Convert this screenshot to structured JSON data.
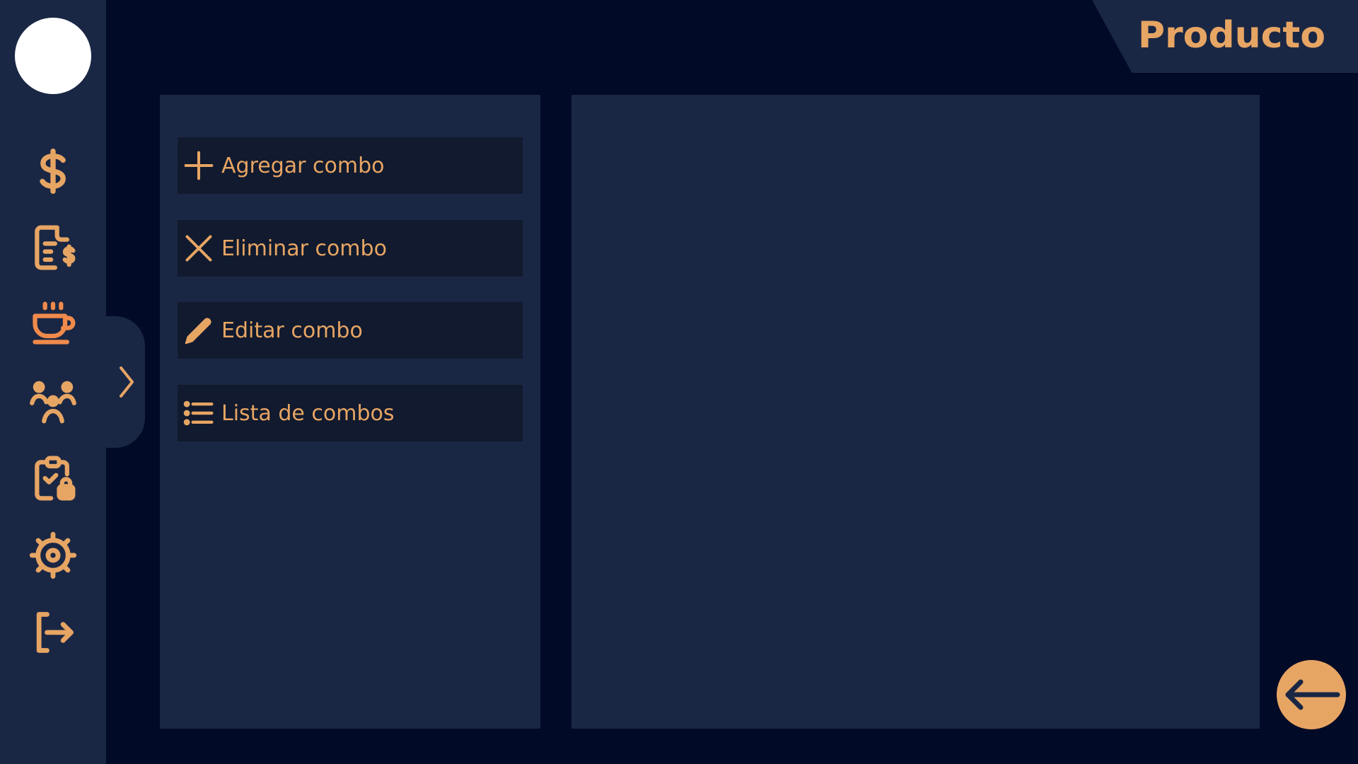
{
  "header": {
    "title": "Producto"
  },
  "sidebar": {
    "items": [
      {
        "icon": "dollar-icon"
      },
      {
        "icon": "invoice-dollar-icon"
      },
      {
        "icon": "coffee-cup-icon",
        "active": true
      },
      {
        "icon": "users-group-icon"
      },
      {
        "icon": "clipboard-check-lock-icon"
      },
      {
        "icon": "settings-gear-icon"
      },
      {
        "icon": "logout-icon"
      }
    ]
  },
  "menu": {
    "items": [
      {
        "label": "Agregar combo",
        "icon": "plus-icon"
      },
      {
        "label": "Eliminar combo",
        "icon": "x-icon"
      },
      {
        "label": "Editar combo",
        "icon": "pencil-icon"
      },
      {
        "label": "Lista de combos",
        "icon": "list-icon"
      }
    ]
  },
  "colors": {
    "background": "#010a26",
    "panel": "#1a2744",
    "button": "#111a2e",
    "accent": "#e7a564",
    "active": "#f08a4b"
  }
}
